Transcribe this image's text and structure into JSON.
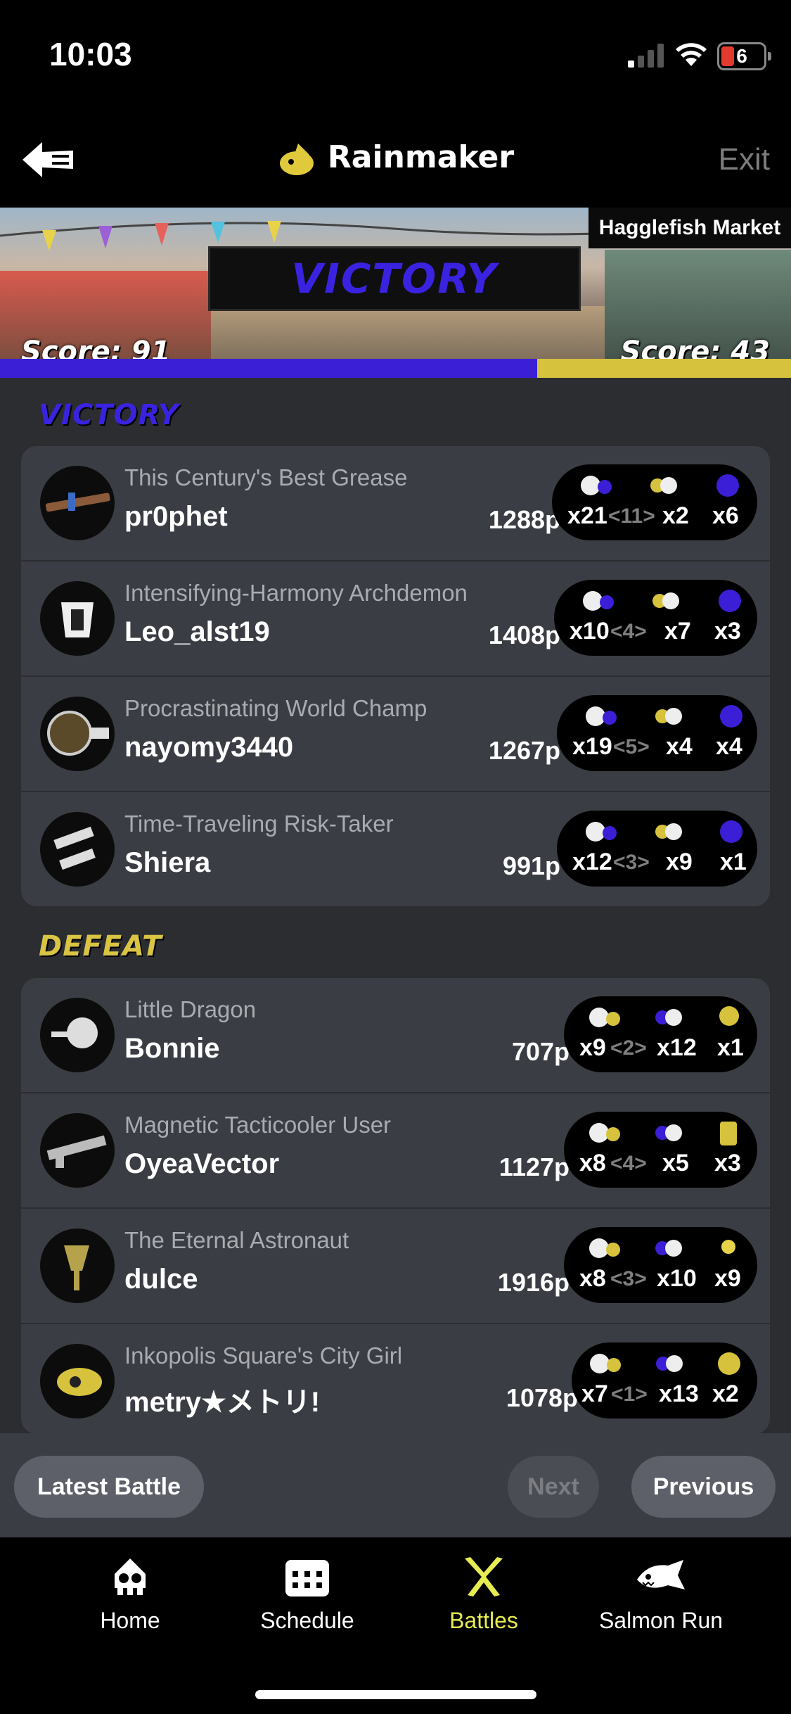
{
  "status_bar": {
    "time": "10:03",
    "battery": "6"
  },
  "nav": {
    "title": "Rainmaker",
    "exit": "Exit"
  },
  "banner": {
    "result": "VICTORY",
    "stage": "Hagglefish Market",
    "score_left": "Score: 91",
    "score_right": "Score: 43",
    "colors": {
      "team_win": "#3a1fd6",
      "team_lose": "#d6c23c"
    }
  },
  "victory": {
    "label": "VICTORY",
    "players": [
      {
        "title": "This Century's Best Grease",
        "name": "pr0phet",
        "points": "1288p",
        "kills": "x21",
        "assists": "<11>",
        "deaths": "x2",
        "specials": "x6"
      },
      {
        "title": "Intensifying-Harmony Archdemon",
        "name": "Leo_alst19",
        "points": "1408p",
        "kills": "x10",
        "assists": "<4>",
        "deaths": "x7",
        "specials": "x3"
      },
      {
        "title": "Procrastinating World Champ",
        "name": "nayomy3440",
        "points": "1267p",
        "kills": "x19",
        "assists": "<5>",
        "deaths": "x4",
        "specials": "x4"
      },
      {
        "title": "Time-Traveling Risk-Taker",
        "name": "Shiera",
        "points": "991p",
        "kills": "x12",
        "assists": "<3>",
        "deaths": "x9",
        "specials": "x1"
      }
    ]
  },
  "defeat": {
    "label": "DEFEAT",
    "players": [
      {
        "title": "Little Dragon",
        "name": "Bonnie",
        "points": "707p",
        "kills": "x9",
        "assists": "<2>",
        "deaths": "x12",
        "specials": "x1"
      },
      {
        "title": "Magnetic Tacticooler User",
        "name": "OyeaVector",
        "points": "1127p",
        "kills": "x8",
        "assists": "<4>",
        "deaths": "x5",
        "specials": "x3"
      },
      {
        "title": "The Eternal Astronaut",
        "name": "dulce",
        "points": "1916p",
        "kills": "x8",
        "assists": "<3>",
        "deaths": "x10",
        "specials": "x9"
      },
      {
        "title": "Inkopolis Square's City Girl",
        "name": "metry★メトリ!",
        "points": "1078p",
        "kills": "x7",
        "assists": "<1>",
        "deaths": "x13",
        "specials": "x2"
      }
    ]
  },
  "actions": {
    "latest": "Latest Battle",
    "next": "Next",
    "previous": "Previous"
  },
  "tabs": [
    {
      "label": "Home",
      "icon": "squid-icon"
    },
    {
      "label": "Schedule",
      "icon": "calendar-icon"
    },
    {
      "label": "Battles",
      "icon": "battles-icon",
      "active": true
    },
    {
      "label": "Salmon Run",
      "icon": "salmon-icon"
    }
  ]
}
